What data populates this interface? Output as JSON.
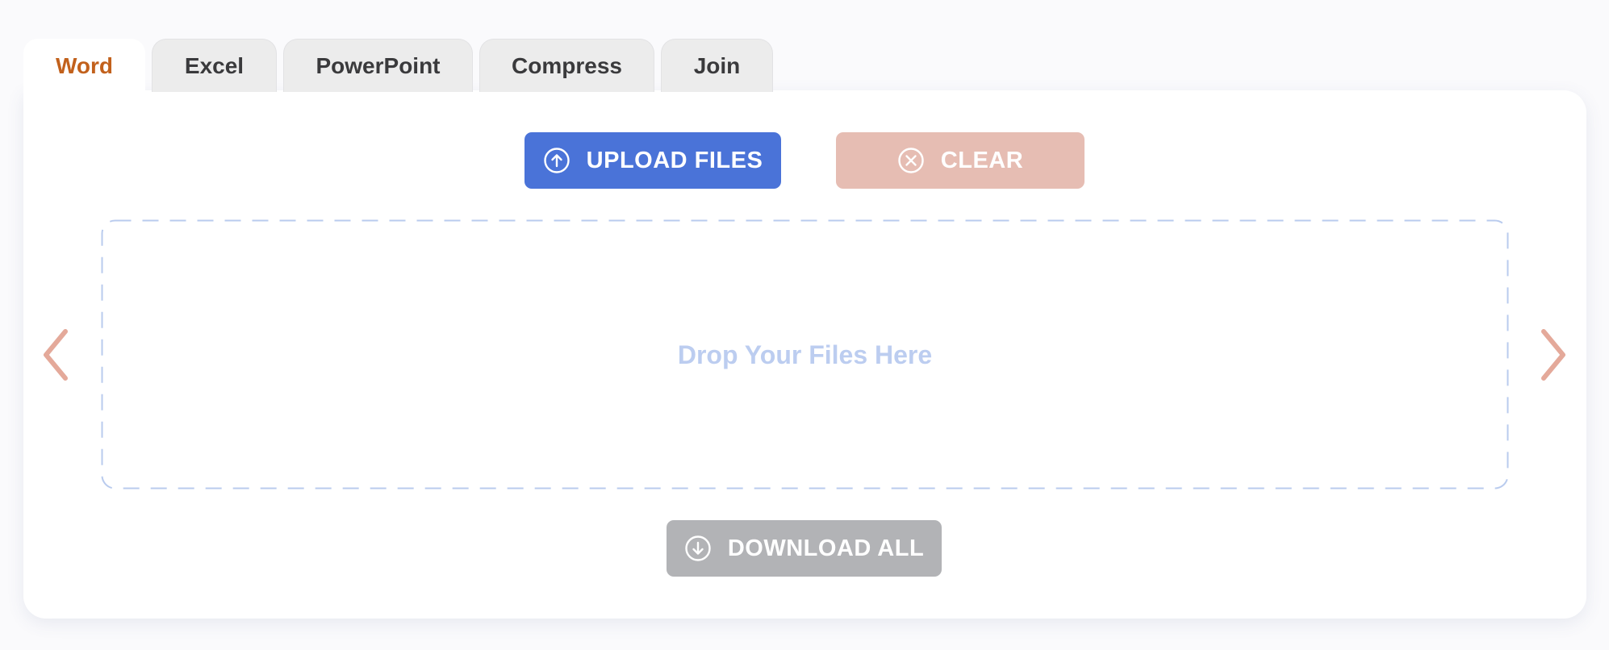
{
  "tabs": [
    {
      "label": "Word",
      "active": true
    },
    {
      "label": "Excel",
      "active": false
    },
    {
      "label": "PowerPoint",
      "active": false
    },
    {
      "label": "Compress",
      "active": false
    },
    {
      "label": "Join",
      "active": false
    }
  ],
  "actions": {
    "upload_label": "UPLOAD FILES",
    "clear_label": "CLEAR",
    "download_label": "DOWNLOAD ALL"
  },
  "dropzone": {
    "text": "Drop Your Files Here"
  },
  "icons": {
    "upload": "upload-circle-arrow-icon",
    "clear": "close-circle-icon",
    "download": "download-circle-arrow-icon",
    "prev": "chevron-left-icon",
    "next": "chevron-right-icon"
  },
  "colors": {
    "active_tab_text": "#c2611c",
    "tab_text": "#3a3a3c",
    "upload_button": "#4a73d8",
    "clear_button": "#e6bdb3",
    "download_button": "#b2b3b6",
    "dropzone_border": "#b9cbee",
    "dropzone_text": "#bccdf0",
    "carousel_arrow": "#e4a99a"
  }
}
